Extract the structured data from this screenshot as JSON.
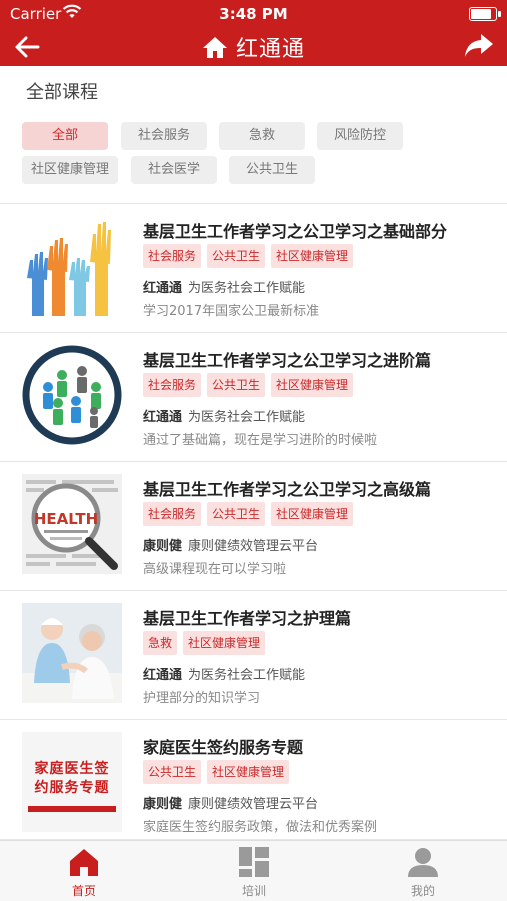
{
  "status_bar": {
    "carrier": "Carrier",
    "time": "3:48 PM",
    "battery_level": 0.9
  },
  "nav": {
    "title": "红通通",
    "back_icon": "back-arrow-icon",
    "home_icon": "home-icon",
    "share_icon": "share-icon"
  },
  "colors": {
    "brand_red": "#c81e1e",
    "tag_bg": "#fbe0e0",
    "tag_text": "#c92b2b",
    "chip_active_bg": "#f6d4d4"
  },
  "section_title": "全部课程",
  "filters": [
    {
      "label": "全部",
      "active": true
    },
    {
      "label": "社会服务",
      "active": false
    },
    {
      "label": "急救",
      "active": false
    },
    {
      "label": "风险防控",
      "active": false
    },
    {
      "label": "社区健康管理",
      "active": false
    },
    {
      "label": "社会医学",
      "active": false
    },
    {
      "label": "公共卫生",
      "active": false
    }
  ],
  "courses": [
    {
      "title": "基层卫生工作者学习之公卫学习之基础部分",
      "tags": [
        "社会服务",
        "公共卫生",
        "社区健康管理"
      ],
      "provider": "红通通",
      "provider_desc": "为医务社会工作赋能",
      "description": "学习2017年国家公卫最新标准",
      "thumb": "hands-illustration"
    },
    {
      "title": "基层卫生工作者学习之公卫学习之进阶篇",
      "tags": [
        "社会服务",
        "公共卫生",
        "社区健康管理"
      ],
      "provider": "红通通",
      "provider_desc": "为医务社会工作赋能",
      "description": "通过了基础篇，现在是学习进阶的时候啦",
      "thumb": "people-circle-illustration"
    },
    {
      "title": "基层卫生工作者学习之公卫学习之高级篇",
      "tags": [
        "社会服务",
        "公共卫生",
        "社区健康管理"
      ],
      "provider": "康则健",
      "provider_desc": "康则健绩效管理云平台",
      "description": "高级课程现在可以学习啦",
      "thumb": "health-magnifier-image",
      "thumb_text": "HEALTH"
    },
    {
      "title": "基层卫生工作者学习之护理篇",
      "tags": [
        "急救",
        "社区健康管理"
      ],
      "provider": "红通通",
      "provider_desc": "为医务社会工作赋能",
      "description": "护理部分的知识学习",
      "thumb": "nurse-photo"
    },
    {
      "title": "家庭医生签约服务专题",
      "tags": [
        "公共卫生",
        "社区健康管理"
      ],
      "provider": "康则健",
      "provider_desc": "康则健绩效管理云平台",
      "description": "家庭医生签约服务政策，做法和优秀案例",
      "thumb": "book-cover",
      "thumb_text": "家庭医生签约服务专题"
    }
  ],
  "tabbar": [
    {
      "label": "首页",
      "icon": "home-tab-icon",
      "active": true
    },
    {
      "label": "培训",
      "icon": "grid-tab-icon",
      "active": false
    },
    {
      "label": "我的",
      "icon": "profile-tab-icon",
      "active": false
    }
  ]
}
